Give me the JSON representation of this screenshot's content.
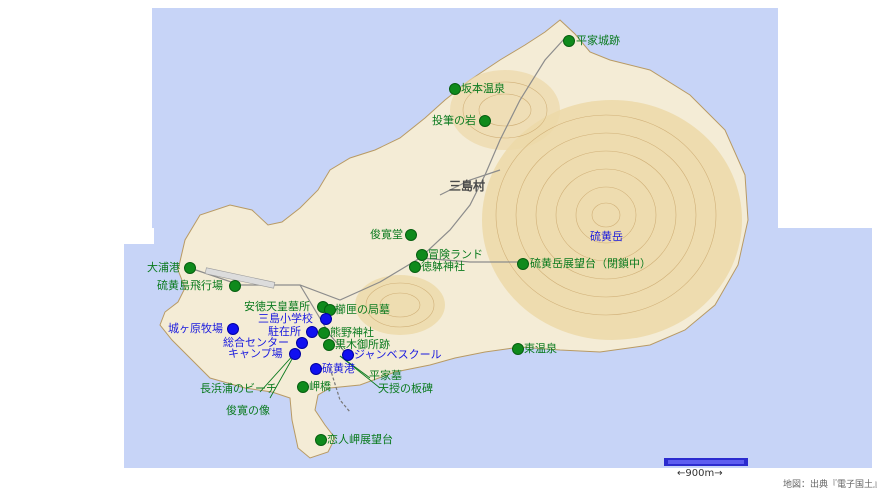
{
  "map": {
    "village_label": "三島村",
    "mountain_label": "硫黄岳",
    "scale_label": "←900m→",
    "credit": "地図：出典『電子国土』",
    "colors": {
      "sea": "#c7d4f7",
      "land": "#f4ecd6",
      "terrain": "#ecd9a8",
      "contour": "#c9a56a",
      "green_marker": "#0f8a1c",
      "blue_marker": "#1010f0",
      "green_text": "#0a7a1e",
      "blue_text": "#1a1adf"
    }
  },
  "places": {
    "heike_castle": "平家城跡",
    "sakamoto_onsen": "坂本温泉",
    "touhitsu_rock": "投筆の岩",
    "shunkan_hall": "俊寛堂",
    "adventure_land": "冒険ランド",
    "tokutai_shrine": "徳躰神社",
    "ioudake_observatory": "硫黄岳展望台（閉鎖中）",
    "ourahama_port": "大浦港",
    "iojima_airfield": "硫黄島飛行場",
    "antoku_tomb": "安徳天皇墓所",
    "kushige_tomb": "櫛匣の局墓",
    "jogahara_ranch": "城ヶ原牧場",
    "mishima_school": "三島小学校",
    "police_box": "駐在所",
    "kumano_shrine": "熊野神社",
    "general_center": "総合センター",
    "kurogi_ruins": "黒木御所跡",
    "campground": "キャンプ場",
    "jambe_school": "ジャンベスクール",
    "higashi_onsen": "東温泉",
    "iojima_port": "硫黄港",
    "heike_tomb": "平家墓",
    "nagahamaura_beach": "長浜浦のビーチ",
    "misaki_bridge": "岬橋",
    "tenju_monument": "天授の板碑",
    "shunkan_statue": "俊寛の像",
    "koibitomisaki_observatory": "恋人岬展望台"
  }
}
